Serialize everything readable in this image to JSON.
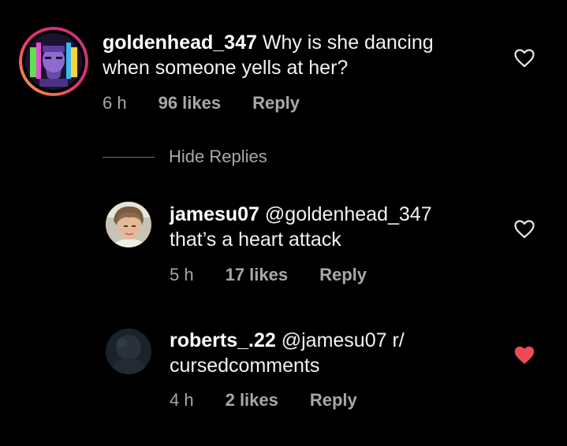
{
  "comments": [
    {
      "username": "goldenhead_347",
      "text": " Why is she dancing when someone yells at her?",
      "time": "6 h",
      "likes": "96 likes",
      "reply": "Reply",
      "liked": false
    }
  ],
  "hide_replies": "Hide Replies",
  "replies": [
    {
      "username": "jamesu07",
      "text_line1": " @goldenhead_347",
      "text_line2": "that’s a heart attack",
      "time": "5 h",
      "likes": "17 likes",
      "reply": "Reply",
      "liked": false
    },
    {
      "username": "roberts_.22",
      "text_line1": " @jamesu07 r/",
      "text_line2": "cursedcomments",
      "time": "4 h",
      "likes": "2 likes",
      "reply": "Reply",
      "liked": true
    }
  ],
  "colors": {
    "background": "#000000",
    "heart_liked": "#ed4956",
    "heart_outline": "#e8e8e8",
    "meta_text": "#a8a8a8"
  },
  "icons": {
    "like": "heart-icon",
    "avatar_ring": "story-ring"
  }
}
